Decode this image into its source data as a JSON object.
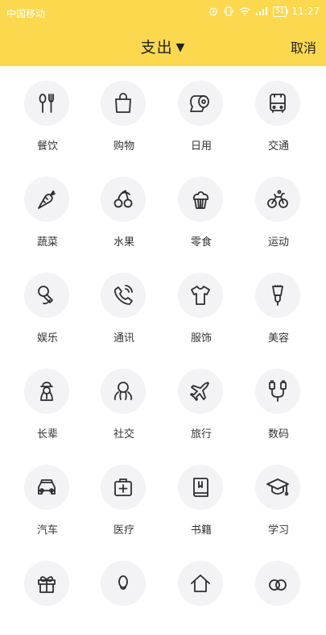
{
  "status_bar": {
    "carrier": "中国移动",
    "battery": "51",
    "time": "11:27"
  },
  "header": {
    "title": "支出",
    "caret": "▼",
    "cancel": "取消"
  },
  "categories": [
    {
      "label": "餐饮",
      "icon": "utensils-icon"
    },
    {
      "label": "购物",
      "icon": "shopping-bag-icon"
    },
    {
      "label": "日用",
      "icon": "toilet-paper-icon"
    },
    {
      "label": "交通",
      "icon": "bus-icon"
    },
    {
      "label": "蔬菜",
      "icon": "carrot-icon"
    },
    {
      "label": "水果",
      "icon": "cherry-icon"
    },
    {
      "label": "零食",
      "icon": "cupcake-icon"
    },
    {
      "label": "运动",
      "icon": "bicycle-icon"
    },
    {
      "label": "娱乐",
      "icon": "microphone-icon"
    },
    {
      "label": "通讯",
      "icon": "phone-icon"
    },
    {
      "label": "服饰",
      "icon": "tshirt-icon"
    },
    {
      "label": "美容",
      "icon": "makeup-brush-icon"
    },
    {
      "label": "长辈",
      "icon": "elder-icon"
    },
    {
      "label": "社交",
      "icon": "social-icon"
    },
    {
      "label": "旅行",
      "icon": "airplane-icon"
    },
    {
      "label": "数码",
      "icon": "cable-icon"
    },
    {
      "label": "汽车",
      "icon": "car-icon"
    },
    {
      "label": "医疗",
      "icon": "medical-kit-icon"
    },
    {
      "label": "书籍",
      "icon": "book-icon"
    },
    {
      "label": "学习",
      "icon": "graduation-cap-icon"
    },
    {
      "label": "",
      "icon": "gift-icon"
    },
    {
      "label": "",
      "icon": "pet-icon"
    },
    {
      "label": "",
      "icon": "home-icon"
    },
    {
      "label": "",
      "icon": "rings-icon"
    }
  ]
}
